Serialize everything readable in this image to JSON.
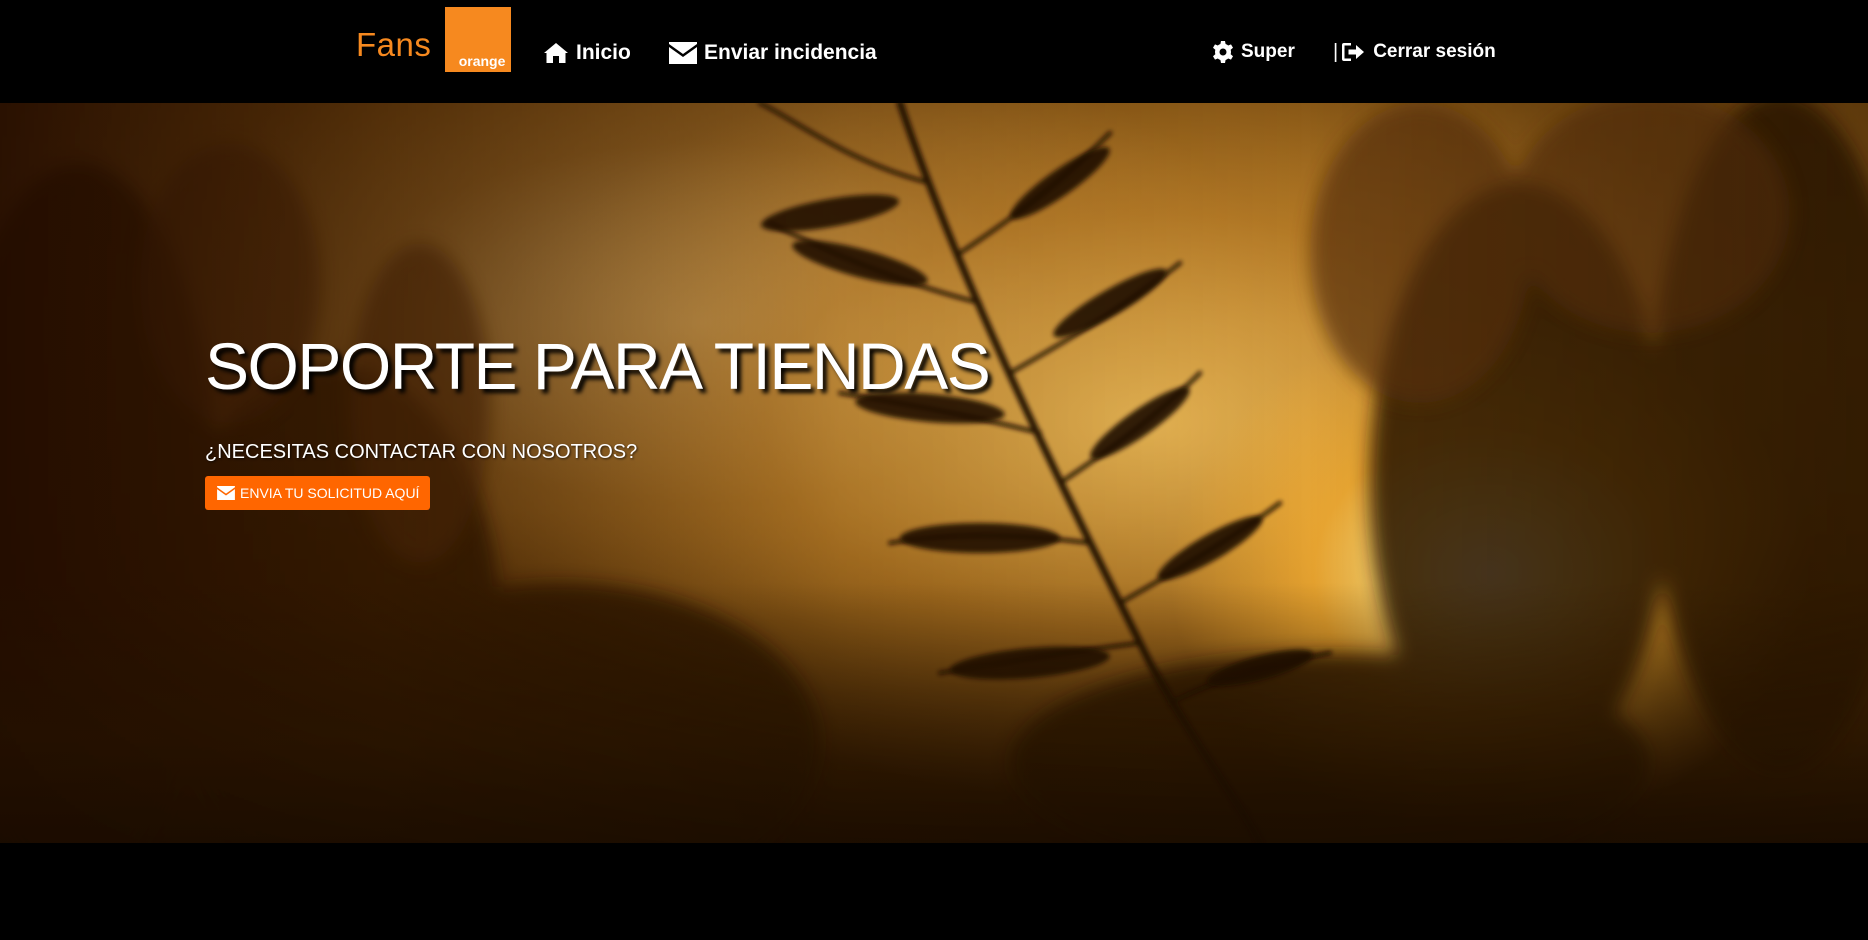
{
  "brand": {
    "name": "Fans",
    "logo_text": "orange",
    "color": "#f6891f"
  },
  "nav": {
    "inicio": "Inicio",
    "enviar_incidencia": "Enviar incidencia",
    "user": "Super",
    "separator": "|",
    "logout": "Cerrar sesión"
  },
  "icons": {
    "inicio": "home-icon",
    "enviar_incidencia": "envelope-icon",
    "user": "gear-icon",
    "logout": "sign-out-icon",
    "hero_button": "envelope-icon"
  },
  "hero": {
    "title": "SOPORTE PARA TIENDAS",
    "subtitle": "¿NECESITAS CONTACTAR CON NOSOTROS?",
    "button_label": "ENVIA TU SOLICITUD AQUÍ",
    "button_color": "#ff6600"
  }
}
